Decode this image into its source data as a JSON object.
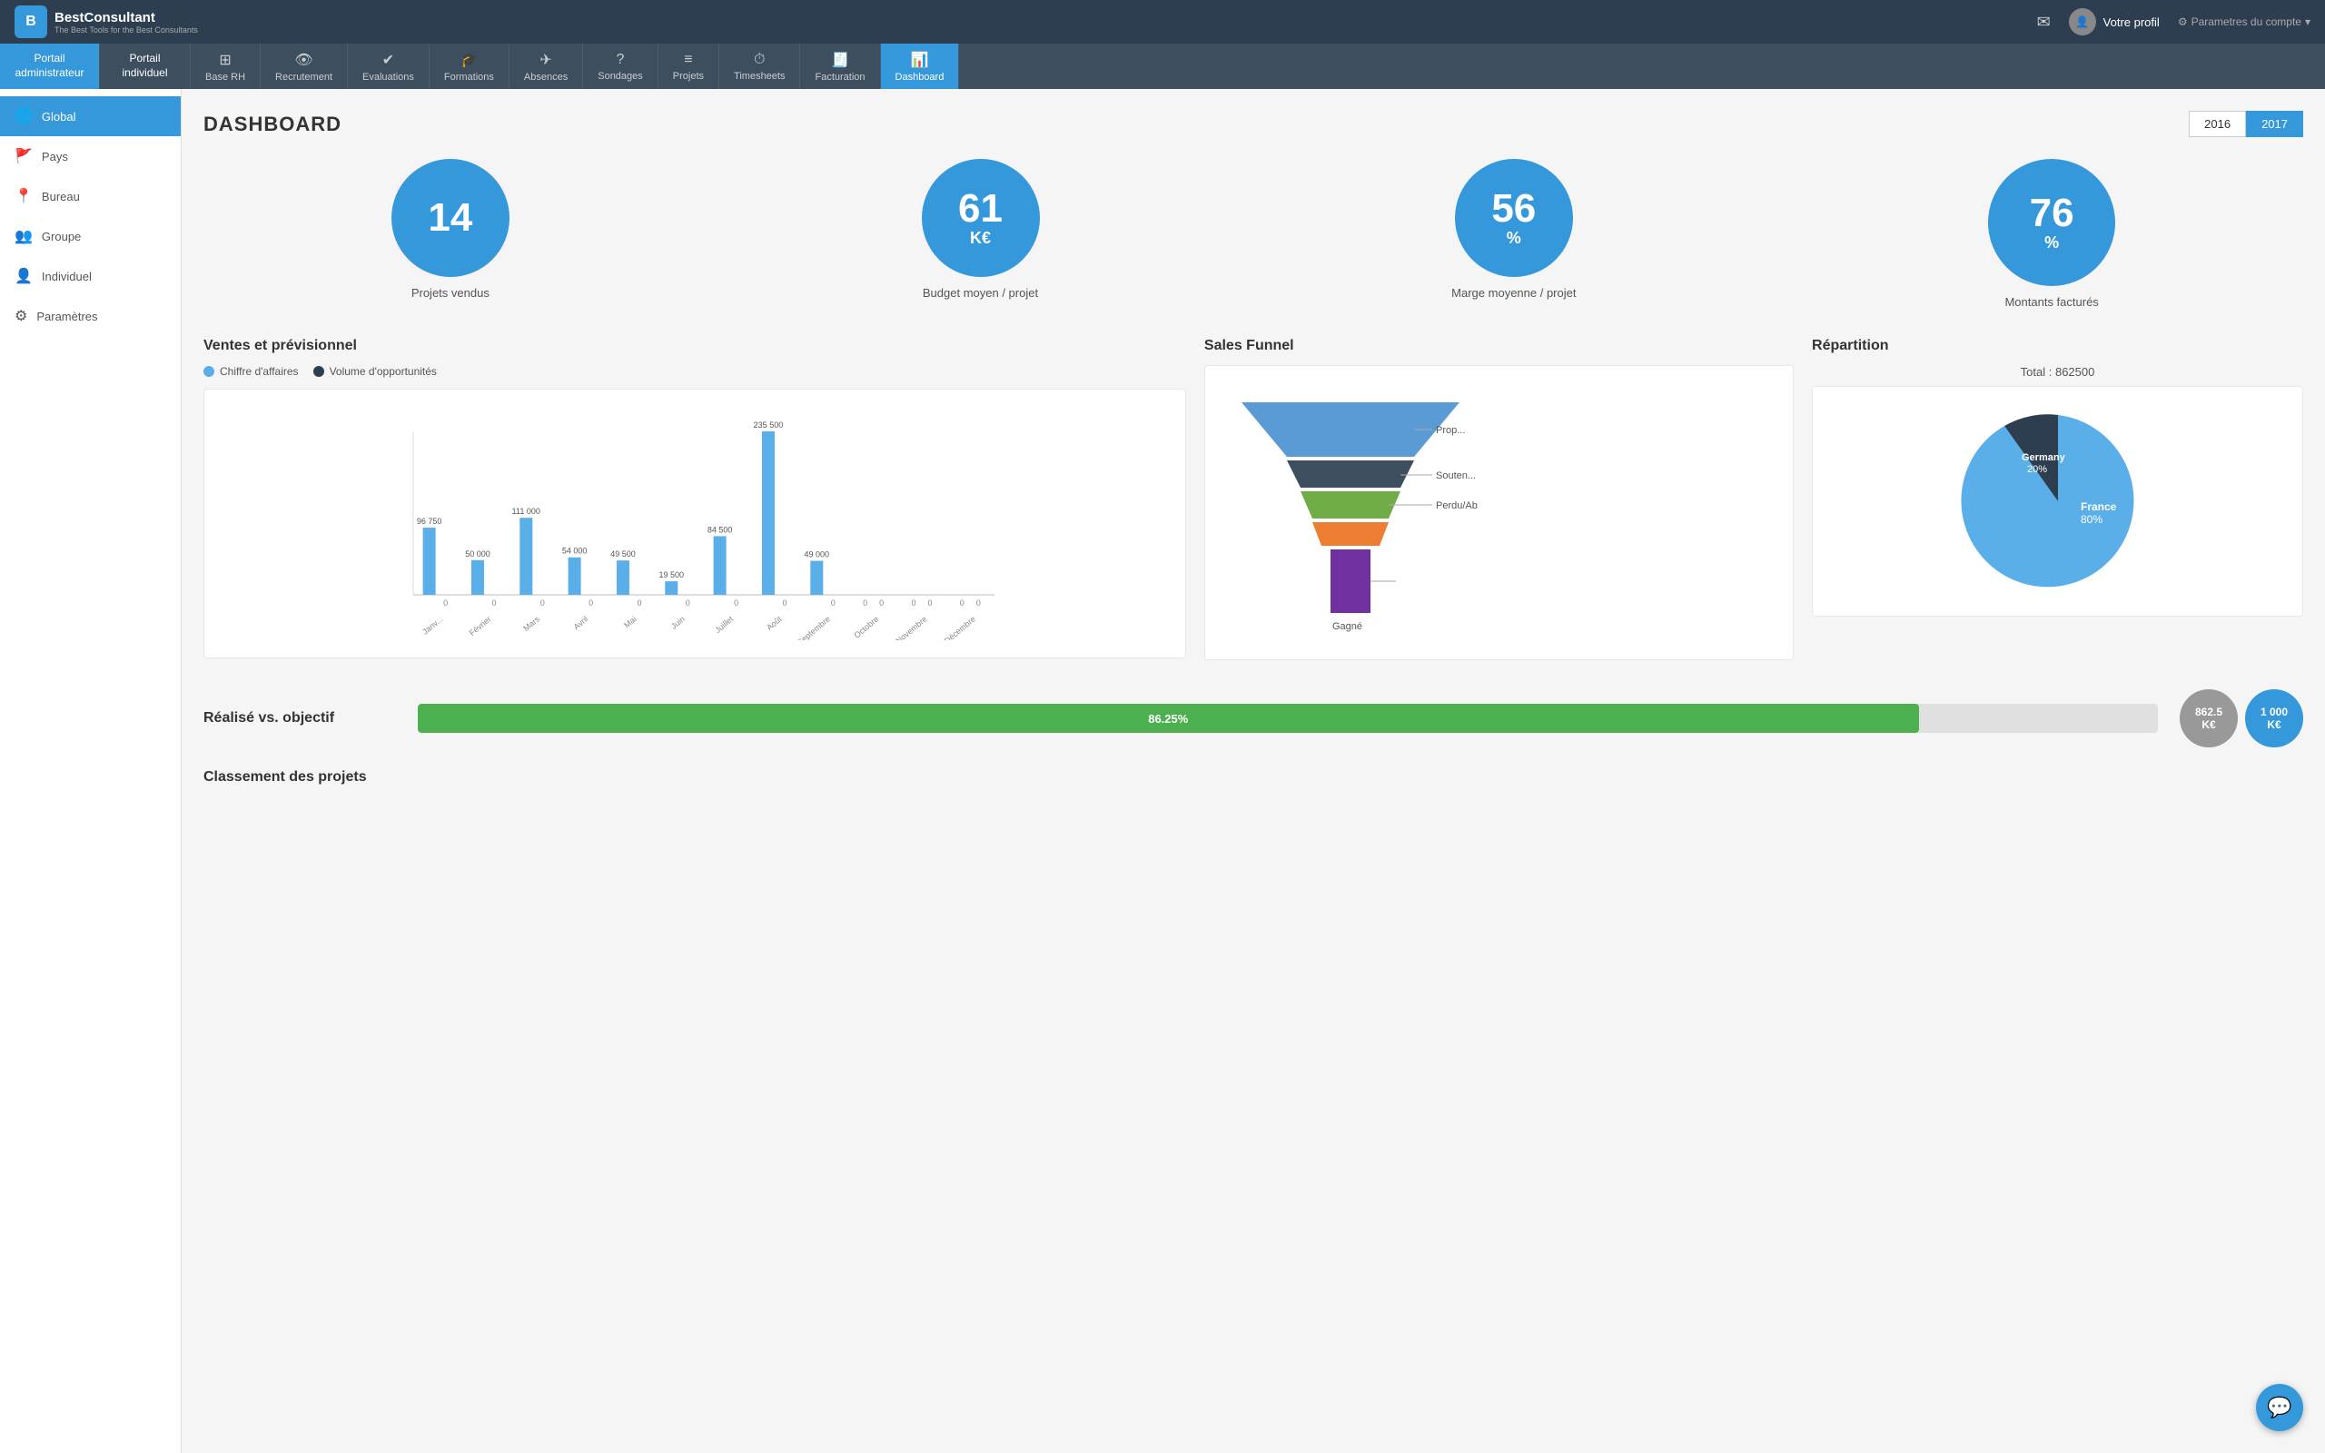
{
  "brand": {
    "logo_letter": "B",
    "name": "BestConsultant",
    "slogan": "The Best Tools for the Best Consultants"
  },
  "top_nav": {
    "mail_icon": "✉",
    "profile_label": "Votre profil",
    "settings_label": "Parametres du compte",
    "chevron": "▾"
  },
  "portal_tabs": [
    {
      "label": "Portail\nadministrateur",
      "active": true
    },
    {
      "label": "Portail\nindividuel",
      "active": false
    }
  ],
  "main_tabs": [
    {
      "icon": "⊞",
      "label": "Base RH",
      "active": false
    },
    {
      "icon": "👁",
      "label": "Recrutement",
      "active": false
    },
    {
      "icon": "✓",
      "label": "Evaluations",
      "active": false
    },
    {
      "icon": "🎓",
      "label": "Formations",
      "active": false
    },
    {
      "icon": "✈",
      "label": "Absences",
      "active": false
    },
    {
      "icon": "?",
      "label": "Sondages",
      "active": false
    },
    {
      "icon": "≡",
      "label": "Projets",
      "active": false
    },
    {
      "icon": "⏱",
      "label": "Timesheets",
      "active": false
    },
    {
      "icon": "⊞",
      "label": "Facturation",
      "active": false
    },
    {
      "icon": "📊",
      "label": "Dashboard",
      "active": true
    }
  ],
  "sidebar": {
    "items": [
      {
        "icon": "🌐",
        "label": "Global",
        "active": true
      },
      {
        "icon": "🚩",
        "label": "Pays",
        "active": false
      },
      {
        "icon": "📍",
        "label": "Bureau",
        "active": false
      },
      {
        "icon": "👥",
        "label": "Groupe",
        "active": false
      },
      {
        "icon": "👤",
        "label": "Individuel",
        "active": false
      },
      {
        "icon": "⚙",
        "label": "Paramètres",
        "active": false
      }
    ]
  },
  "dashboard": {
    "title": "DASHBOARD",
    "year_buttons": [
      "2016",
      "2017"
    ],
    "active_year": "2017"
  },
  "kpis": [
    {
      "num": "14",
      "unit": "",
      "label": "Projets vendus"
    },
    {
      "num": "61",
      "unit": "K€",
      "label": "Budget moyen / projet"
    },
    {
      "num": "56",
      "unit": "%",
      "label": "Marge moyenne / projet"
    },
    {
      "num": "76",
      "unit": "%",
      "label": "Montants facturés"
    }
  ],
  "bar_chart": {
    "title": "Ventes et prévisionnel",
    "legend": [
      {
        "color": "#5aafe8",
        "label": "Chiffre d'affaires"
      },
      {
        "color": "#2c3e50",
        "label": "Volume d'opportunités"
      }
    ],
    "months": [
      {
        "label": "Janv...",
        "val1": 96750,
        "val2": 0
      },
      {
        "label": "Février",
        "val1": 50000,
        "val2": 0
      },
      {
        "label": "Mars",
        "val1": 111000,
        "val2": 0
      },
      {
        "label": "Avril",
        "val1": 54000,
        "val2": 0
      },
      {
        "label": "Mai",
        "val1": 49500,
        "val2": 0
      },
      {
        "label": "Juin",
        "val1": 19500,
        "val2": 0
      },
      {
        "label": "Juillet",
        "val1": 84500,
        "val2": 0
      },
      {
        "label": "Août",
        "val1": 235500,
        "val2": 0
      },
      {
        "label": "Septembre",
        "val1": 49000,
        "val2": 0
      },
      {
        "label": "Octobre",
        "val1": 0,
        "val2": 0
      },
      {
        "label": "Novembre",
        "val1": 0,
        "val2": 0
      },
      {
        "label": "Décembre",
        "val1": 0,
        "val2": 0
      }
    ]
  },
  "funnel": {
    "title": "Sales Funnel",
    "stages": [
      {
        "label": "Prop...",
        "color": "#5b9bd5"
      },
      {
        "label": "Souten...",
        "color": "#70ad47"
      },
      {
        "label": "Perdu/Ab...",
        "color": "#ed7d31"
      },
      {
        "label": "Gagné",
        "color": "#7030a0"
      }
    ]
  },
  "pie": {
    "title": "Répartition",
    "total_label": "Total : 862500",
    "slices": [
      {
        "label": "France",
        "value": 80,
        "color": "#5aafe8"
      },
      {
        "label": "Germany",
        "value": 20,
        "color": "#2c3e50"
      }
    ]
  },
  "progress": {
    "title": "Réalisé vs. objectif",
    "percent": 86.25,
    "percent_label": "86.25%",
    "achieved": "862.5\nK€",
    "target": "1 000\nK€"
  },
  "classement_title": "Classement des projets",
  "chat_icon": "💬"
}
